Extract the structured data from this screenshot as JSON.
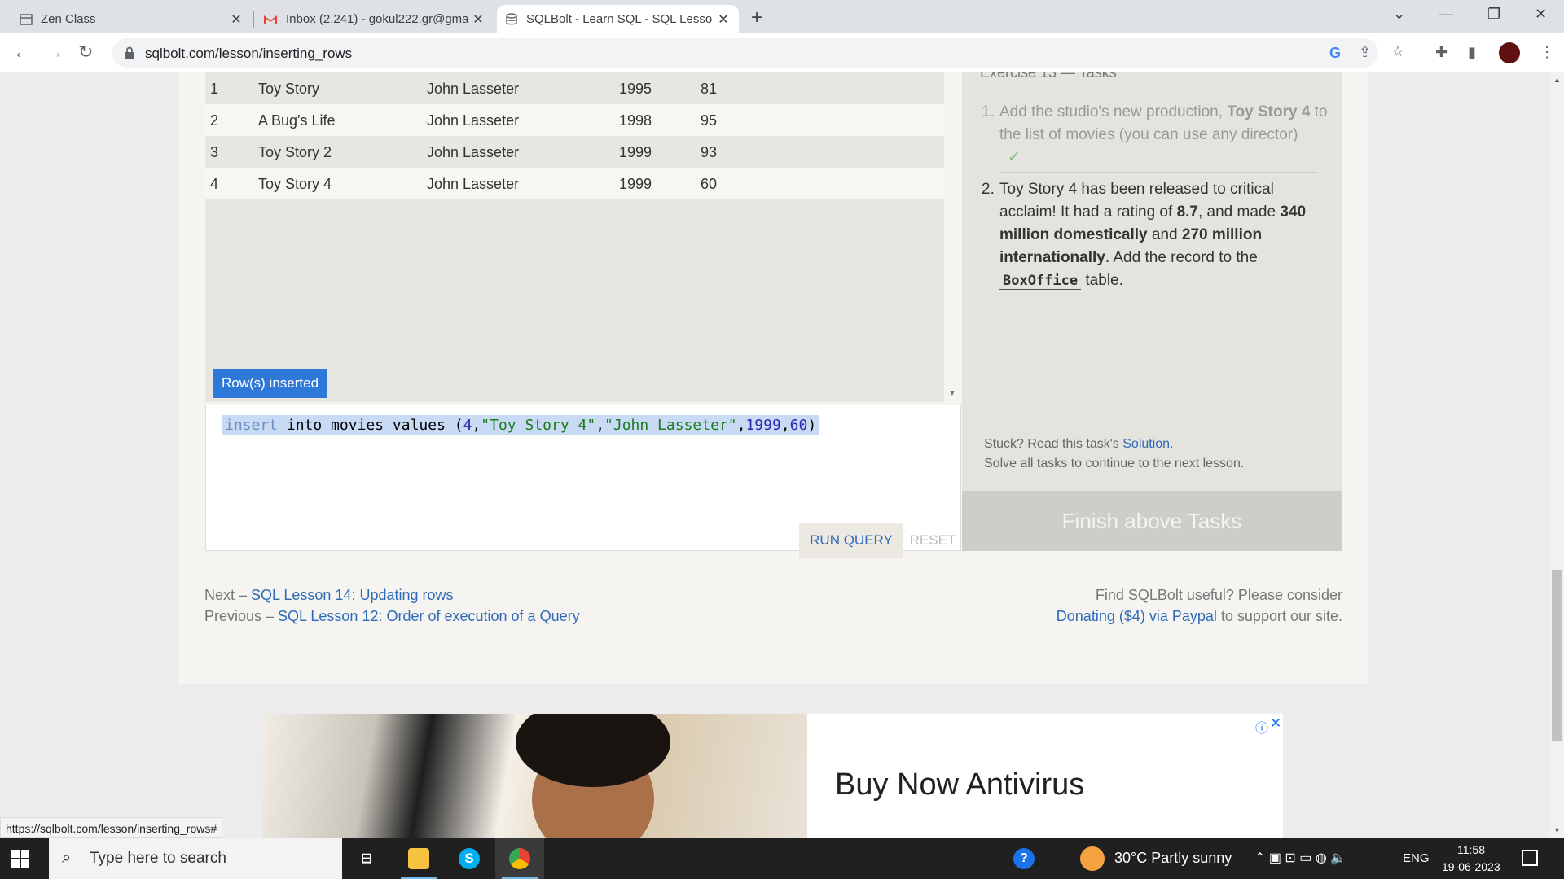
{
  "browser": {
    "tabs": [
      {
        "title": "Zen Class",
        "icon": "page-icon"
      },
      {
        "title": "Inbox (2,241) - gokul222.gr@gma",
        "icon": "gmail-icon"
      },
      {
        "title": "SQLBolt - Learn SQL - SQL Lesso",
        "icon": "database-icon",
        "active": true
      }
    ],
    "close_glyph": "✕",
    "url": "sqlbolt.com/lesson/inserting_rows"
  },
  "results": {
    "rows": [
      {
        "id": "1",
        "title": "Toy Story",
        "director": "John Lasseter",
        "year": "1995",
        "length": "81"
      },
      {
        "id": "2",
        "title": "A Bug's Life",
        "director": "John Lasseter",
        "year": "1998",
        "length": "95"
      },
      {
        "id": "3",
        "title": "Toy Story 2",
        "director": "John Lasseter",
        "year": "1999",
        "length": "93"
      },
      {
        "id": "4",
        "title": "Toy Story 4",
        "director": "John Lasseter",
        "year": "1999",
        "length": "60"
      }
    ],
    "status": "Row(s) inserted"
  },
  "editor": {
    "query_parts": {
      "kw_insert": "insert",
      "mid": " into movies values (",
      "id": "4",
      "comma1": ",",
      "title": "\"Toy Story 4\"",
      "comma2": ",",
      "director": "\"John Lasseter\"",
      "comma3": ",",
      "year": "1999",
      "comma4": ",",
      "length": "60",
      "close": ")"
    },
    "run_label": "RUN QUERY",
    "reset_label": "RESET"
  },
  "tasks": {
    "heading": "Exercise 13 — Tasks",
    "task1": {
      "num": "1.",
      "pre": "Add the studio's new production, ",
      "bold": "Toy Story 4",
      "post": " to the list of movies (you can use any director)",
      "check": "✓"
    },
    "task2": {
      "num": "2.",
      "t1": "Toy Story 4 has been released to critical acclaim! It had a rating of ",
      "b1": "8.7",
      "t2": ", and made ",
      "b2": "340 million domestically",
      "t3": " and ",
      "b3": "270 million internationally",
      "t4": ". Add the record to the ",
      "code": "BoxOffice",
      "t5": " table."
    },
    "stuck_pre": "Stuck? Read this task's ",
    "stuck_link": "Solution",
    "stuck_post": ".",
    "solve_all": "Solve all tasks to continue to the next lesson.",
    "finish_label": "Finish above Tasks"
  },
  "footer": {
    "next_pre": "Next – ",
    "next_link": "SQL Lesson 14: Updating rows",
    "prev_pre": "Previous – ",
    "prev_link": "SQL Lesson 12: Order of execution of a Query",
    "donate_line1": "Find SQLBolt useful? Please consider",
    "donate_link": "Donating ($4) via Paypal",
    "donate_post": " to support our site."
  },
  "ad": {
    "headline": "Buy Now Antivirus",
    "info_glyph": "ⓘ",
    "close_glyph": "✕"
  },
  "status_bar_url": "https://sqlbolt.com/lesson/inserting_rows#",
  "taskbar": {
    "search_placeholder": "Type here to search",
    "weather": "30°C  Partly sunny",
    "lang": "ENG",
    "time": "11:58",
    "date": "19-06-2023",
    "apps": [
      "task-view-icon",
      "file-explorer-icon",
      "skype-icon",
      "chrome-icon"
    ]
  },
  "colors": {
    "accent_blue": "#2e78d9",
    "link_blue": "#2e6ab8",
    "finish_disabled": "#cfcdc8"
  }
}
